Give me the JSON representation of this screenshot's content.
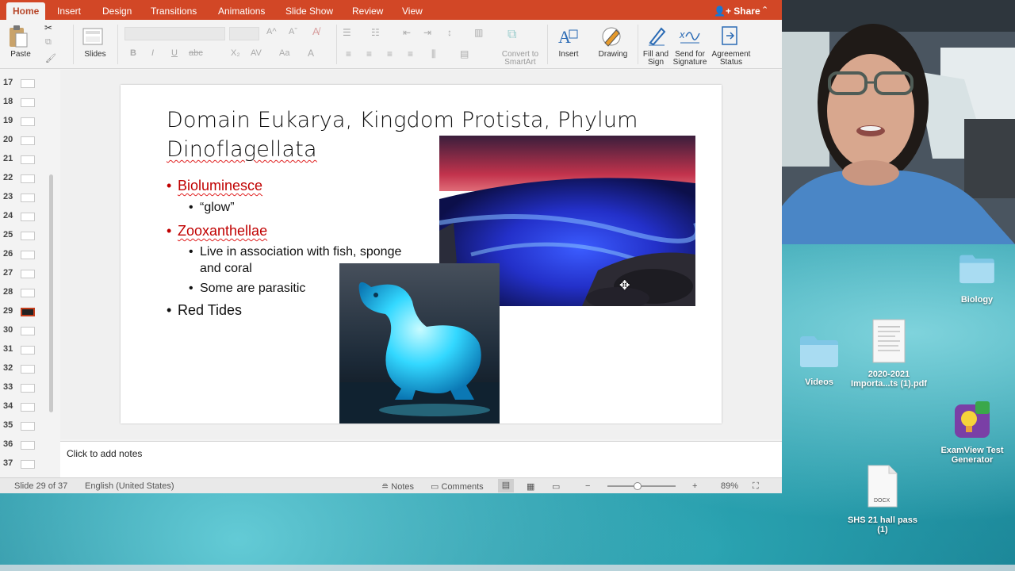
{
  "ribbon_tabs": [
    "Home",
    "Insert",
    "Design",
    "Transitions",
    "Animations",
    "Slide Show",
    "Review",
    "View"
  ],
  "share_label": "Share",
  "ribbon": {
    "paste": "Paste",
    "slides": "Slides",
    "convert_smartart_1": "Convert to",
    "convert_smartart_2": "SmartArt",
    "insert": "Insert",
    "drawing": "Drawing",
    "fill_sign_1": "Fill and",
    "fill_sign_2": "Sign",
    "send_sig_1": "Send for",
    "send_sig_2": "Signature",
    "agreement_1": "Agreement",
    "agreement_2": "Status",
    "bold": "B",
    "italic": "I",
    "underline": "U",
    "strike": "abc",
    "subscript": "X₂"
  },
  "thumbnails": [
    "17",
    "18",
    "19",
    "20",
    "21",
    "22",
    "23",
    "24",
    "25",
    "26",
    "27",
    "28",
    "29",
    "30",
    "31",
    "32",
    "33",
    "34",
    "35",
    "36",
    "37"
  ],
  "selected_slide": "29",
  "slide": {
    "title_line1": "Domain Eukarya, Kingdom Protista, Phylum",
    "title_line2": "Dinoflagellata",
    "bullet1": "Bioluminesce",
    "bullet1_sub": "“glow”",
    "bullet2": "Zooxanthellae",
    "bullet2_sub1_a": "Live in association with fish, sponge",
    "bullet2_sub1_b": "and coral",
    "bullet2_sub2": "Some are parasitic",
    "bullet3": "Red Tides"
  },
  "notes_placeholder": "Click to add notes",
  "status": {
    "slide_count": "Slide 29 of 37",
    "language": "English (United States)",
    "notes": "Notes",
    "comments": "Comments",
    "zoom": "89%",
    "minus": "−",
    "plus": "+"
  },
  "desktop": {
    "biology": "Biology",
    "videos": "Videos",
    "pdf_line1": "2020-2021",
    "pdf_line2": "Importa...ts (1).pdf",
    "examview_line1": "ExamView Test",
    "examview_line2": "Generator",
    "docx_tag": "DOCX",
    "hallpass_line1": "SHS 21 hall pass",
    "hallpass_line2": "(1)"
  },
  "colors": {
    "accent": "#d24726",
    "bullet_red": "#c00000"
  }
}
